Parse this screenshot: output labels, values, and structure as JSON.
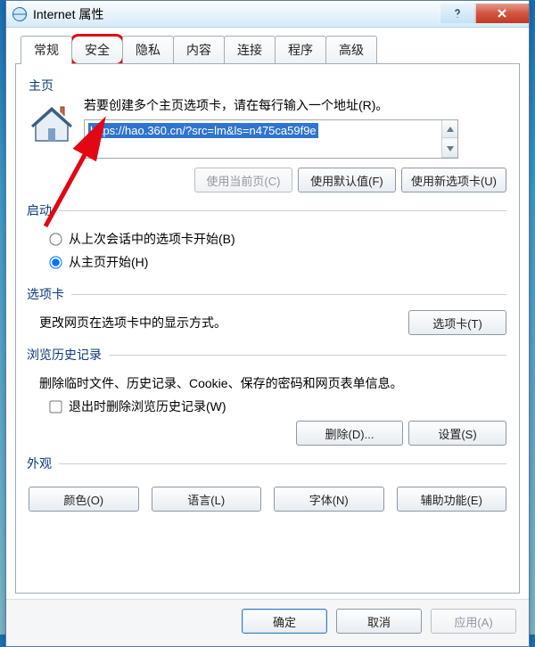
{
  "window": {
    "title": "Internet 属性"
  },
  "tabs": {
    "general": "常规",
    "security": "安全",
    "privacy": "隐私",
    "content": "内容",
    "connections": "连接",
    "programs": "程序",
    "advanced": "高级"
  },
  "home": {
    "label": "主页",
    "hint": "若要创建多个主页选项卡，请在每行输入一个地址(R)。",
    "url": "https://hao.360.cn/?src=lm&ls=n475ca59f9e",
    "use_current": "使用当前页(C)",
    "use_default": "使用默认值(F)",
    "use_newtab": "使用新选项卡(U)"
  },
  "startup": {
    "label": "启动",
    "opt_last": "从上次会话中的选项卡开始(B)",
    "opt_home": "从主页开始(H)"
  },
  "tabsection": {
    "label": "选项卡",
    "desc": "更改网页在选项卡中的显示方式。",
    "btn": "选项卡(T)"
  },
  "history": {
    "label": "浏览历史记录",
    "desc": "删除临时文件、历史记录、Cookie、保存的密码和网页表单信息。",
    "del_on_exit": "退出时删除浏览历史记录(W)",
    "delete_btn": "删除(D)...",
    "settings_btn": "设置(S)"
  },
  "appearance": {
    "label": "外观",
    "color": "颜色(O)",
    "language": "语言(L)",
    "font": "字体(N)",
    "accessibility": "辅助功能(E)"
  },
  "footer": {
    "ok": "确定",
    "cancel": "取消",
    "apply": "应用(A)"
  }
}
